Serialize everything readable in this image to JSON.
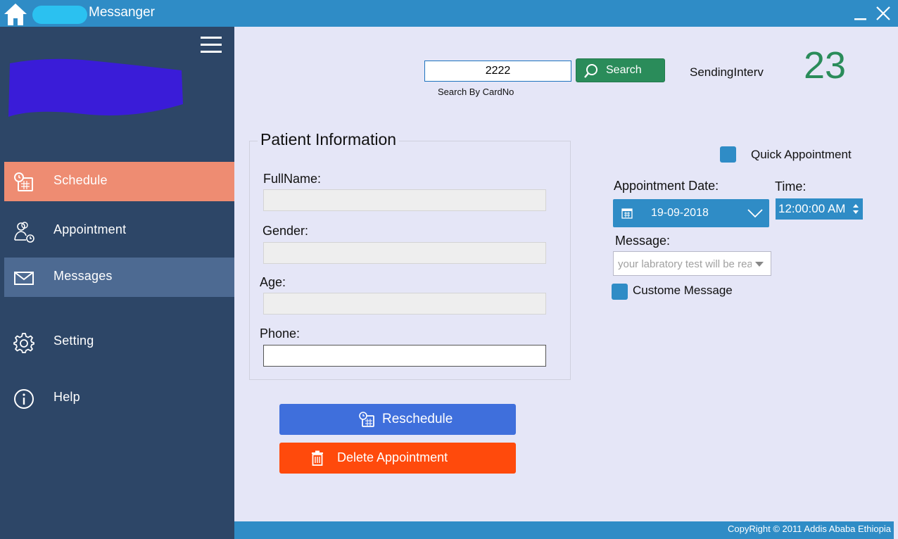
{
  "window": {
    "title": "Messanger",
    "minimize_icon": "minimize-icon",
    "close_icon": "close-icon"
  },
  "sidebar": {
    "menu_icon": "hamburger-icon",
    "items": [
      {
        "label": "Schedule",
        "icon": "calendar-clock-icon",
        "state": "active"
      },
      {
        "label": "Appointment",
        "icon": "users-clock-icon",
        "state": "normal"
      },
      {
        "label": "Messages",
        "icon": "envelope-icon",
        "state": "hover"
      },
      {
        "label": "Setting",
        "icon": "gear-icon",
        "state": "normal"
      },
      {
        "label": "Help",
        "icon": "info-icon",
        "state": "normal"
      }
    ]
  },
  "search": {
    "value": "2222",
    "button_label": "Search",
    "hint": "Search By CardNo"
  },
  "interval": {
    "label": "SendingInterv",
    "value": "23"
  },
  "patient": {
    "group_title": "Patient Information",
    "fields": [
      {
        "label": "FullName:",
        "value": ""
      },
      {
        "label": "Gender:",
        "value": ""
      },
      {
        "label": "Age:",
        "value": ""
      },
      {
        "label": "Phone:",
        "value": ""
      }
    ]
  },
  "actions": {
    "reschedule_label": "Reschedule",
    "delete_label": "Delete Appointment"
  },
  "appointment": {
    "quick_label": "Quick Appointment",
    "date_label": "Appointment Date:",
    "date_value": "19-09-2018",
    "time_label": "Time:",
    "time_value": "12:00:00 AM",
    "message_label": "Message:",
    "message_value": "your labratory test will be ready",
    "custom_label": "Custome Message"
  },
  "footer": {
    "copyright": "CopyRight © 2011 Addis Ababa Ethiopia"
  },
  "colors": {
    "titlebar": "#2f8cc6",
    "sidebar": "#2d4667",
    "active_item": "#ee8c72",
    "search_button": "#2a8c5a",
    "reschedule_button": "#3f6fdc",
    "delete_button": "#ff4a0c"
  }
}
